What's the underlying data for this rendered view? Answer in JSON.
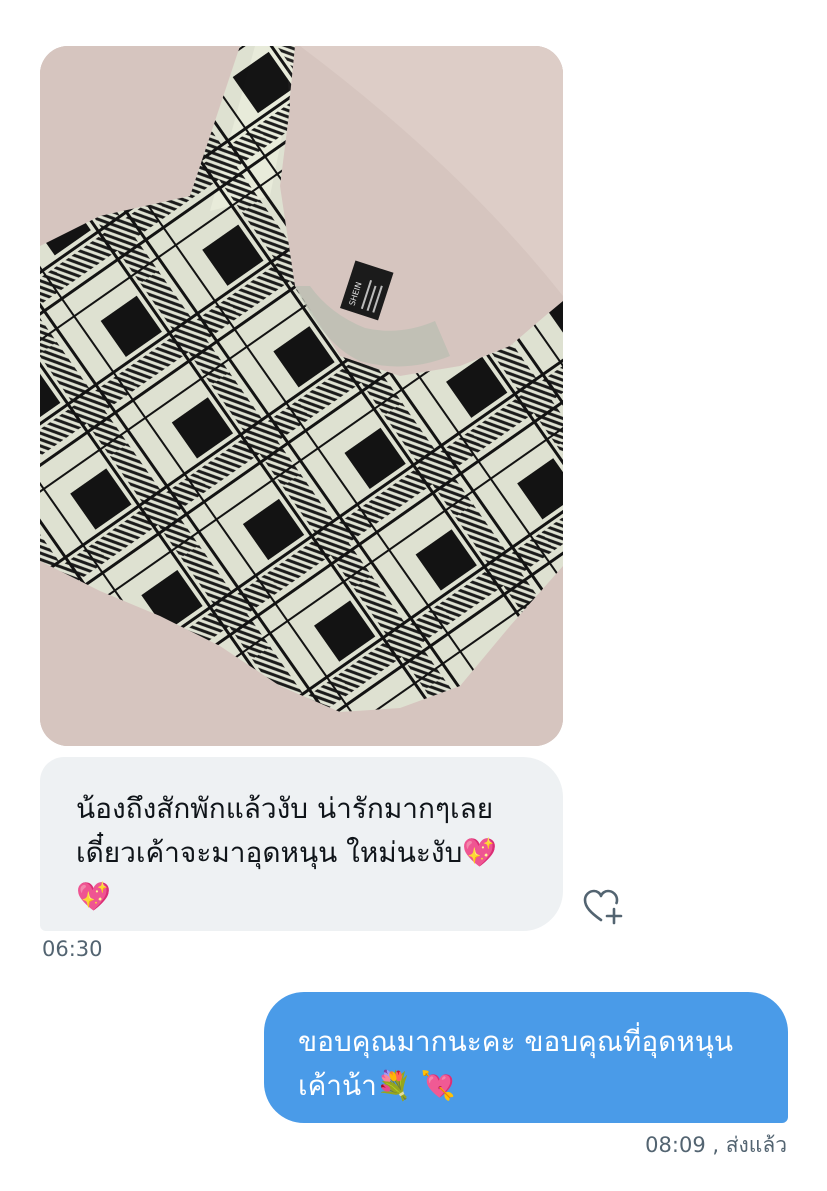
{
  "conversation": {
    "incoming_photo": {
      "alt": "Black and white plaid crop top",
      "label_text": "SHEIN"
    },
    "incoming_message": {
      "text": "น้องถึงสักพักแล้วงับ น่ารักมากๆเลย\nเดี๋ยวเค้าจะมาอุดหนุน ใหม่นะงับ💖\n💖",
      "time": "06:30"
    },
    "reaction_button": {
      "icon": "heart-plus-icon"
    },
    "outgoing_message": {
      "text": "ขอบคุณมากนะคะ ขอบคุณที่อุดหนุน\nเค้าน้า💐 💘",
      "time": "08:09",
      "status": ", ส่งแล้ว"
    }
  },
  "colors": {
    "incoming_bubble": "#eef1f3",
    "outgoing_bubble": "#4a9be8",
    "meta_text": "#536471"
  }
}
